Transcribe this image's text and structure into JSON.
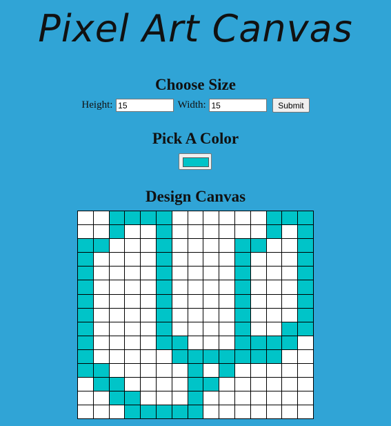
{
  "page": {
    "title": "Pixel Art Canvas",
    "background_color": "#30a4d6"
  },
  "size_section": {
    "heading": "Choose Size",
    "height_label": "Height:",
    "height_value": "15",
    "width_label": "Width:",
    "width_value": "15",
    "submit_label": "Submit"
  },
  "color_section": {
    "heading": "Pick A Color",
    "selected_color": "#00c4c8"
  },
  "canvas_section": {
    "heading": "Design Canvas",
    "rows": 15,
    "cols": 15,
    "empty_color": "#ffffff",
    "filled_cells": [
      [
        0,
        2
      ],
      [
        0,
        3
      ],
      [
        0,
        4
      ],
      [
        0,
        5
      ],
      [
        0,
        12
      ],
      [
        0,
        13
      ],
      [
        0,
        14
      ],
      [
        1,
        2
      ],
      [
        1,
        5
      ],
      [
        1,
        12
      ],
      [
        1,
        14
      ],
      [
        2,
        0
      ],
      [
        2,
        1
      ],
      [
        2,
        5
      ],
      [
        2,
        10
      ],
      [
        2,
        11
      ],
      [
        2,
        14
      ],
      [
        3,
        0
      ],
      [
        3,
        5
      ],
      [
        3,
        10
      ],
      [
        3,
        14
      ],
      [
        4,
        0
      ],
      [
        4,
        5
      ],
      [
        4,
        10
      ],
      [
        4,
        14
      ],
      [
        5,
        0
      ],
      [
        5,
        5
      ],
      [
        5,
        10
      ],
      [
        5,
        14
      ],
      [
        6,
        0
      ],
      [
        6,
        5
      ],
      [
        6,
        10
      ],
      [
        6,
        14
      ],
      [
        7,
        0
      ],
      [
        7,
        5
      ],
      [
        7,
        10
      ],
      [
        7,
        14
      ],
      [
        8,
        0
      ],
      [
        8,
        5
      ],
      [
        8,
        10
      ],
      [
        8,
        13
      ],
      [
        8,
        14
      ],
      [
        9,
        0
      ],
      [
        9,
        5
      ],
      [
        9,
        6
      ],
      [
        9,
        10
      ],
      [
        9,
        11
      ],
      [
        9,
        12
      ],
      [
        9,
        13
      ],
      [
        10,
        0
      ],
      [
        10,
        6
      ],
      [
        10,
        7
      ],
      [
        10,
        8
      ],
      [
        10,
        9
      ],
      [
        10,
        10
      ],
      [
        10,
        11
      ],
      [
        10,
        12
      ],
      [
        11,
        0
      ],
      [
        11,
        1
      ],
      [
        11,
        7
      ],
      [
        11,
        9
      ],
      [
        12,
        1
      ],
      [
        12,
        2
      ],
      [
        12,
        7
      ],
      [
        12,
        8
      ],
      [
        13,
        2
      ],
      [
        13,
        3
      ],
      [
        13,
        7
      ],
      [
        14,
        3
      ],
      [
        14,
        4
      ],
      [
        14,
        5
      ],
      [
        14,
        6
      ],
      [
        14,
        7
      ]
    ]
  }
}
